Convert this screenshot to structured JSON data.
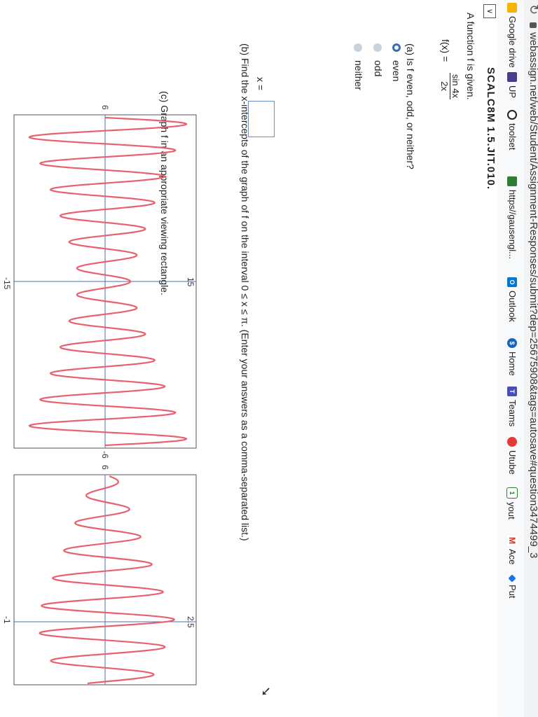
{
  "browser": {
    "url_text": "webassign.net/web/Student/Assignment-Responses/submit?dep=25675908&tags=autosave#question3474499_3"
  },
  "bookmarks": [
    {
      "label": "Google drive",
      "icon": "google-drive-icon",
      "color": "#f4b400"
    },
    {
      "label": "UP",
      "icon": "up-icon",
      "color": "#4a3c8c"
    },
    {
      "label": "toolset",
      "icon": "toolset-icon",
      "color": "#222222"
    },
    {
      "label": "https//gausengl...",
      "icon": "bookmark-site-icon",
      "color": "#2e7d32"
    },
    {
      "label": "Outlook",
      "icon": "outlook-icon",
      "color": "#0078d4"
    },
    {
      "label": "Home",
      "icon": "home-icon",
      "color": "#1565c0"
    },
    {
      "label": "Teams",
      "icon": "teams-icon",
      "color": "#464eb8"
    },
    {
      "label": "Utube",
      "icon": "utube-icon",
      "color": "#e53935"
    },
    {
      "label": "yout",
      "icon": "yout-icon",
      "color": "#2e7d32"
    },
    {
      "label": "Ace",
      "icon": "gmail-icon",
      "color": "#d93025"
    },
    {
      "label": "Put",
      "icon": "put-icon",
      "color": "#1a73e8"
    }
  ],
  "header": {
    "menu_glyph": "∨",
    "title": "SCALC8M 1.5.JIT.010."
  },
  "question": {
    "intro": "A function f is given.",
    "f_label": "f(x) =",
    "frac_num": "sin 4x",
    "frac_den": "2x",
    "part_a_prompt": "(a) Is f even, odd, or neither?",
    "options": [
      "even",
      "odd",
      "neither"
    ],
    "selected_option": "even",
    "part_b_prompt": "(b) Find the x-intercepts of the graph of f on the interval  0 ≤ x ≤ π.  (Enter your answers as a comma-separated list.)",
    "x_label": "x =",
    "x_value": "",
    "part_c_prompt": "(c) Graph f in an appropriate viewing rectangle."
  },
  "graphs": [
    {
      "left_tick_label": "-15",
      "right_tick_label": "15",
      "top_tick_label": "6",
      "bottom_tick_label": "-6"
    },
    {
      "right_tick_label": "2.5",
      "left_tick_label": "-1",
      "top_tick_label": "6",
      "bottom_tick_label": "-6"
    }
  ],
  "colors": {
    "curve": "#e8616e",
    "axis": "#4a6fb5",
    "frame": "#555555",
    "radio_selected": "#3b6cb7"
  }
}
